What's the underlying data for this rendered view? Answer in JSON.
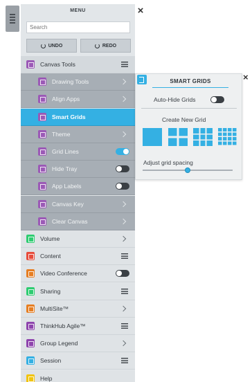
{
  "menu": {
    "title": "MENU",
    "search_placeholder": "Search",
    "undo_label": "UNDO",
    "redo_label": "REDO"
  },
  "items": [
    {
      "label": "Canvas Tools",
      "level": "top",
      "icon_color": "#9b59b6",
      "right": "lines"
    },
    {
      "label": "Drawing Tools",
      "level": "sub",
      "icon_color": "#9b59b6",
      "right": "chevron"
    },
    {
      "label": "Align Apps",
      "level": "sub",
      "icon_color": "#9b59b6",
      "right": "chevron"
    },
    {
      "label": "Smart Grids",
      "level": "active",
      "icon_color": "#9b59b6",
      "right": "none"
    },
    {
      "label": "Theme",
      "level": "sub",
      "icon_color": "#9b59b6",
      "right": "chevron"
    },
    {
      "label": "Grid Lines",
      "level": "sub",
      "icon_color": "#9b59b6",
      "right": "toggle-on"
    },
    {
      "label": "Hide Tray",
      "level": "sub",
      "icon_color": "#9b59b6",
      "right": "toggle-off"
    },
    {
      "label": "App Labels",
      "level": "sub",
      "icon_color": "#9b59b6",
      "right": "toggle-off"
    },
    {
      "label": "Canvas Key",
      "level": "sub",
      "icon_color": "#9b59b6",
      "right": "chevron"
    },
    {
      "label": "Clear Canvas",
      "level": "sub",
      "icon_color": "#9b59b6",
      "right": "chevron"
    },
    {
      "label": "Volume",
      "level": "main",
      "icon_color": "#2ecc71",
      "right": "chevron"
    },
    {
      "label": "Content",
      "level": "main",
      "icon_color": "#e74c3c",
      "right": "lines"
    },
    {
      "label": "Video Conference",
      "level": "main",
      "icon_color": "#e67e22",
      "right": "toggle-off"
    },
    {
      "label": "Sharing",
      "level": "main",
      "icon_color": "#2ecc71",
      "right": "lines"
    },
    {
      "label": "MultiSite™",
      "level": "main",
      "icon_color": "#e67e22",
      "right": "chevron"
    },
    {
      "label": "ThinkHub Agile™",
      "level": "main",
      "icon_color": "#8e44ad",
      "right": "lines"
    },
    {
      "label": "Group Legend",
      "level": "main",
      "icon_color": "#8e44ad",
      "right": "chevron"
    },
    {
      "label": "Session",
      "level": "main",
      "icon_color": "#34b0e3",
      "right": "lines"
    },
    {
      "label": "Help",
      "level": "main",
      "icon_color": "#f1c40f",
      "right": "none"
    }
  ],
  "smart_grids": {
    "title": "SMART GRIDS",
    "auto_hide_label": "Auto-Hide Grids",
    "create_label": "Create New Grid",
    "spacing_label": "Adjust grid spacing",
    "spacing_value": 0.5
  }
}
